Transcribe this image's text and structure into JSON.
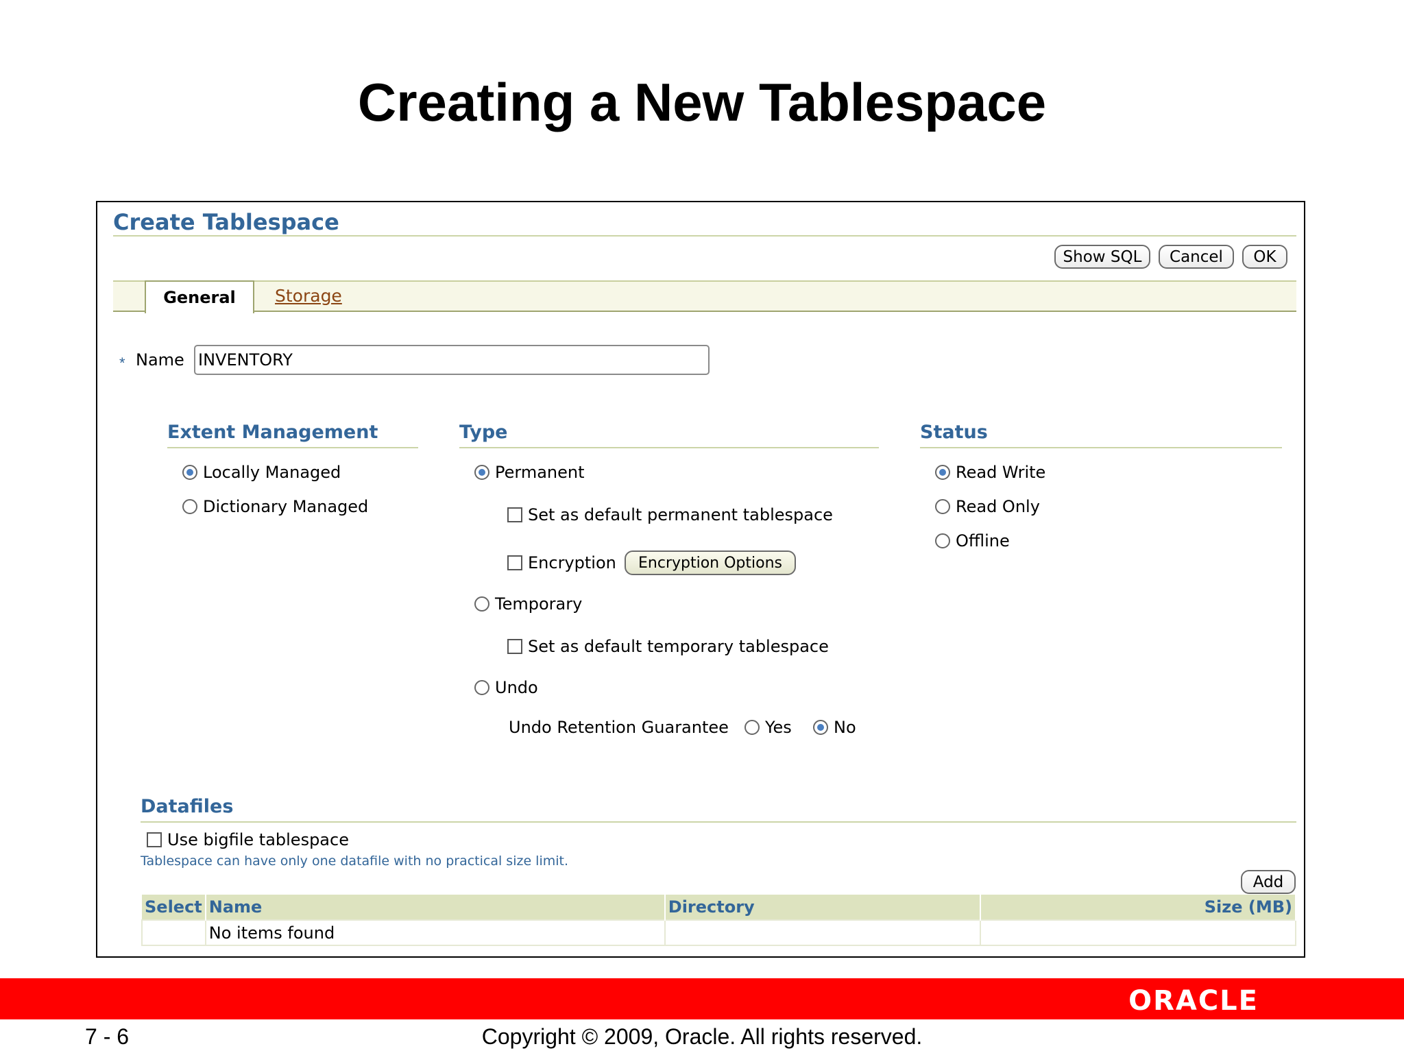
{
  "slide": {
    "title": "Creating a New Tablespace",
    "page_number": "7 - 6",
    "copyright": "Copyright © 2009, Oracle. All rights reserved.",
    "logo": "ORACLE",
    "accent_color": "#ff0000"
  },
  "panel": {
    "title": "Create Tablespace",
    "buttons": {
      "show_sql": "Show SQL",
      "cancel": "Cancel",
      "ok": "OK"
    },
    "tabs": {
      "general": "General",
      "storage": "Storage"
    },
    "name_field": {
      "required_mark": "*",
      "label": "Name",
      "value": "INVENTORY"
    },
    "extent_management": {
      "heading": "Extent Management",
      "options": [
        {
          "label": "Locally Managed",
          "selected": true
        },
        {
          "label": "Dictionary Managed",
          "selected": false
        }
      ]
    },
    "type": {
      "heading": "Type",
      "permanent": "Permanent",
      "default_permanent": "Set as default permanent tablespace",
      "encryption": "Encryption",
      "encryption_options_button": "Encryption Options",
      "temporary": "Temporary",
      "default_temporary": "Set as default temporary tablespace",
      "undo": "Undo",
      "undo_retention_label": "Undo Retention Guarantee",
      "undo_retention_yes": "Yes",
      "undo_retention_no": "No",
      "selected": "Permanent",
      "undo_retention_selected": "No"
    },
    "status": {
      "heading": "Status",
      "options": [
        {
          "label": "Read Write",
          "selected": true
        },
        {
          "label": "Read Only",
          "selected": false
        },
        {
          "label": "Offline",
          "selected": false
        }
      ]
    },
    "datafiles": {
      "heading": "Datafiles",
      "bigfile_label": "Use bigfile tablespace",
      "bigfile_checked": false,
      "hint": "Tablespace can have only one datafile with no practical size limit.",
      "add_button": "Add",
      "columns": [
        "Select",
        "Name",
        "Directory",
        "Size (MB)"
      ],
      "empty_message": "No items found"
    },
    "header_color": "#336699"
  }
}
